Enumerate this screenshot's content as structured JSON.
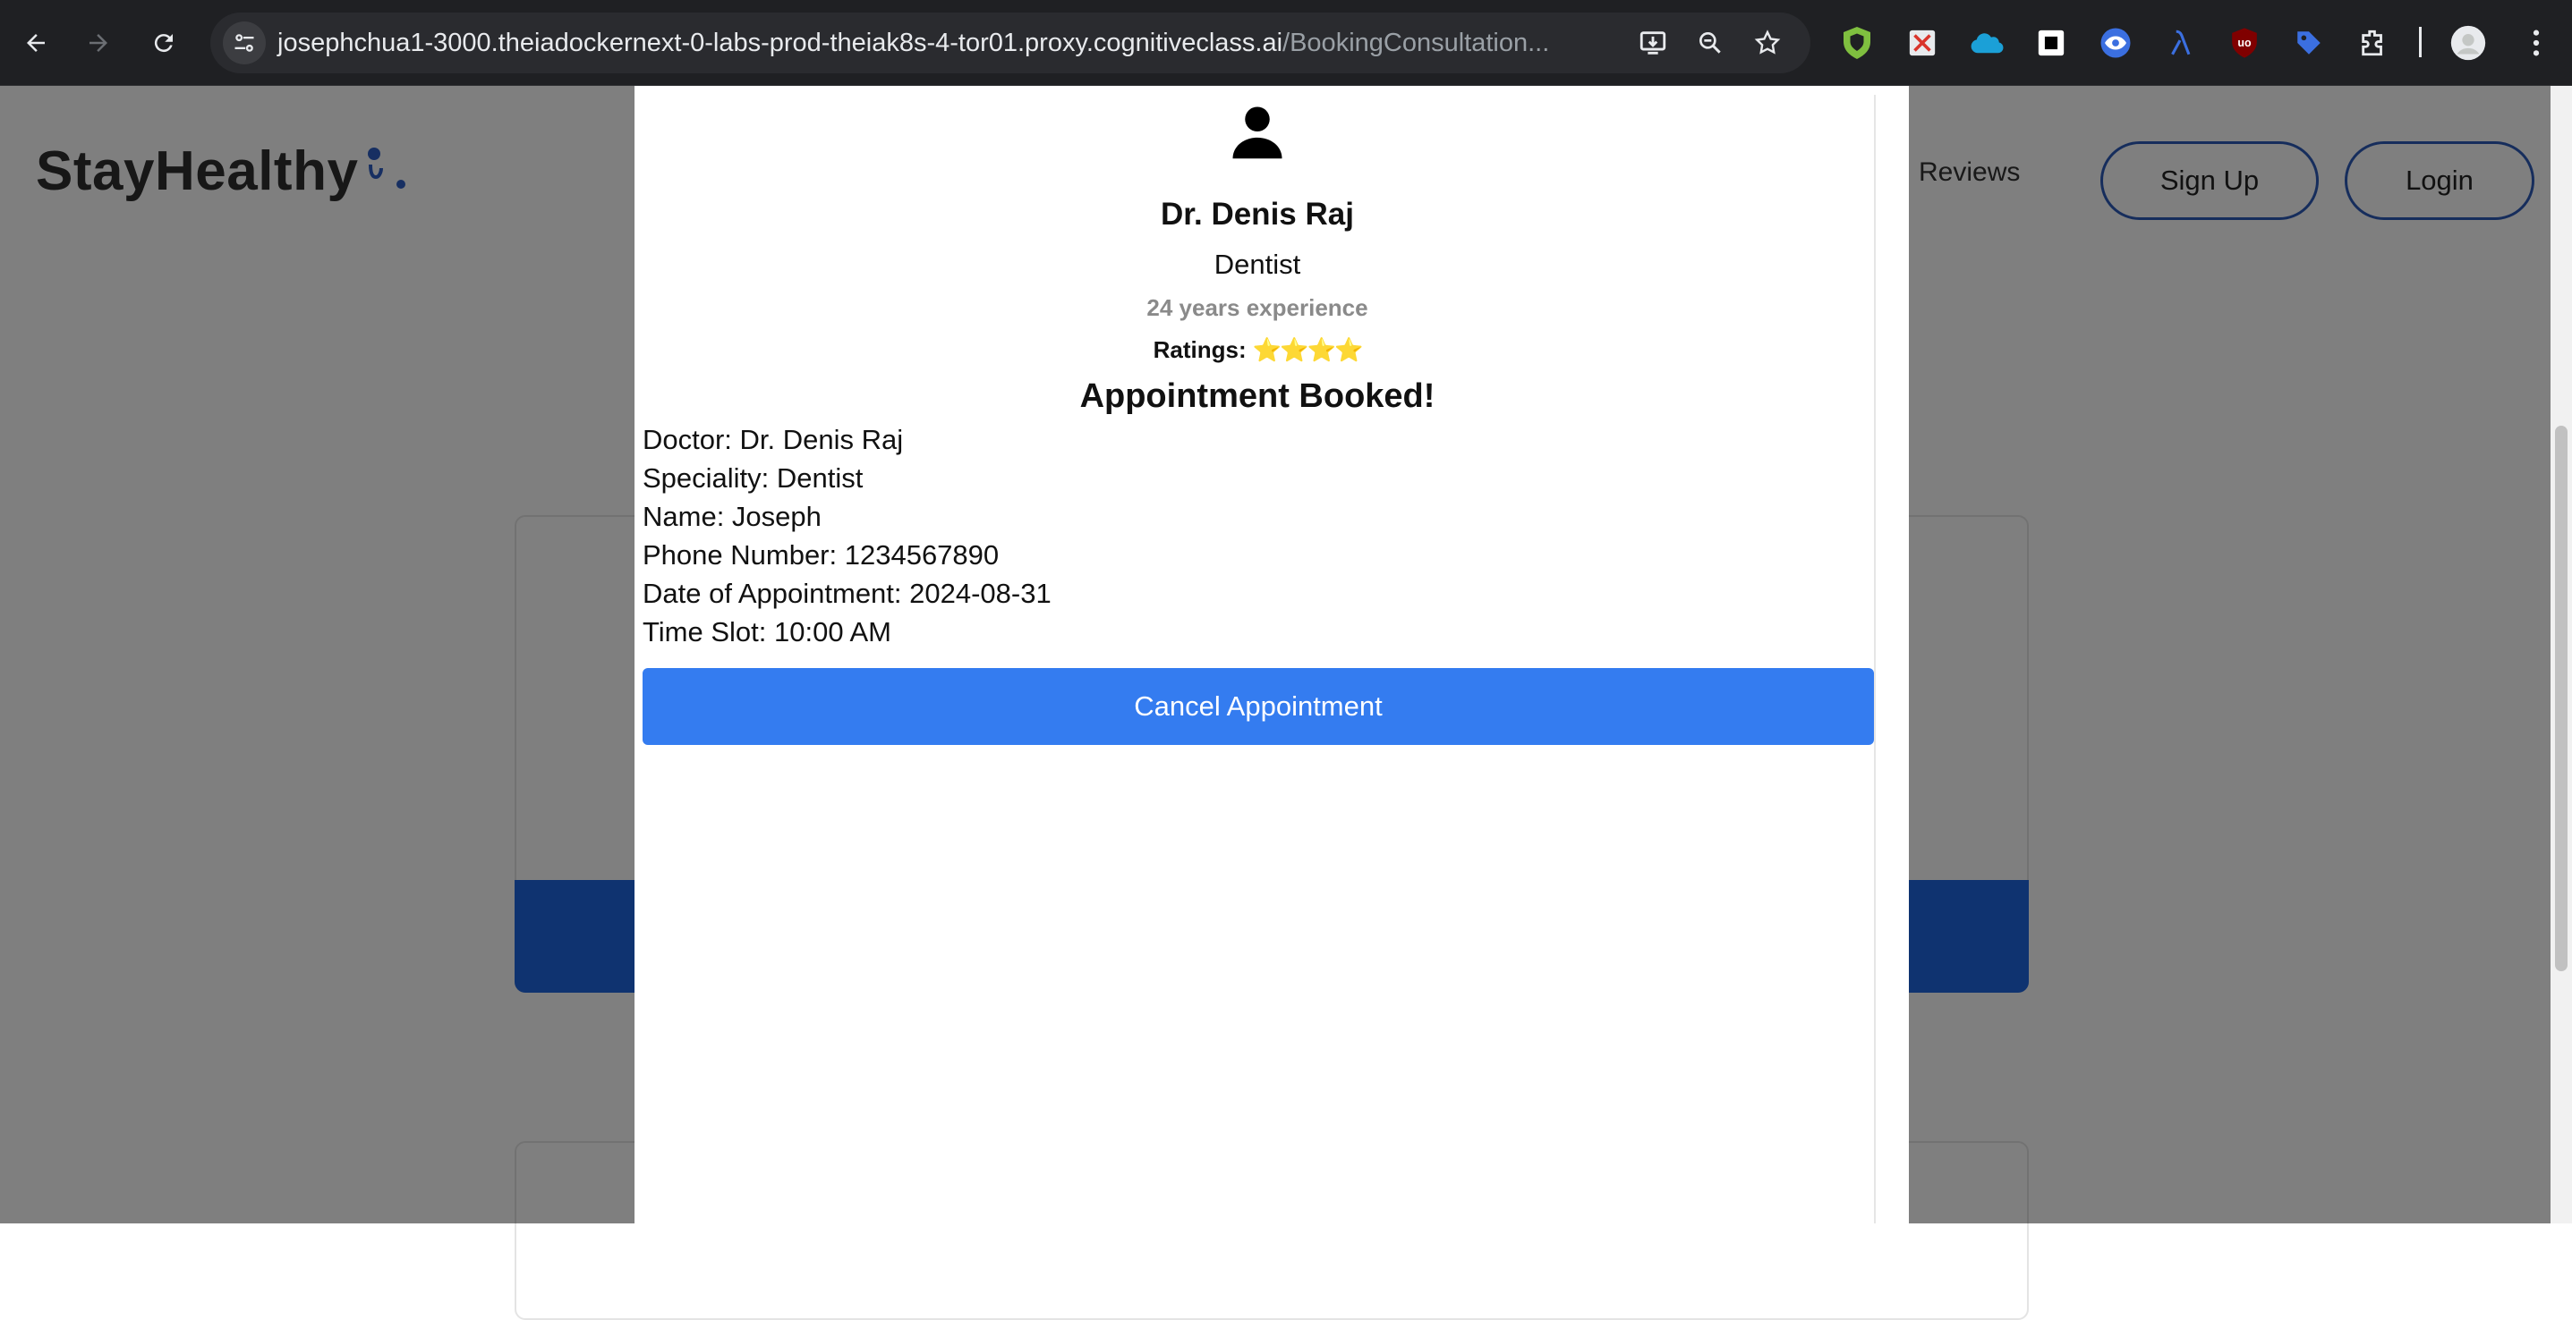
{
  "browser": {
    "url_host": "josephchua1-3000.theiadockernext-0-labs-prod-theiak8s-4-tor01.proxy.cognitiveclass.ai",
    "url_path": "/BookingConsultation..."
  },
  "site": {
    "logo_text": "StayHealthy",
    "nav_reviews": "Reviews",
    "signup_label": "Sign Up",
    "login_label": "Login"
  },
  "modal": {
    "doctor_name": "Dr. Denis Raj",
    "speciality": "Dentist",
    "experience": "24 years experience",
    "ratings_label": "Ratings:",
    "ratings_stars": "⭐⭐⭐⭐",
    "booked_title": "Appointment Booked!",
    "details": [
      "Doctor: Dr. Denis Raj",
      "Speciality: Dentist",
      "Name: Joseph",
      "Phone Number: 1234567890",
      "Date of Appointment: 2024-08-31",
      "Time Slot: 10:00 AM"
    ],
    "cancel_label": "Cancel Appointment"
  },
  "colors": {
    "accent": "#347cf0",
    "brand_outline": "#2d5bb9",
    "overlay": "rgba(0,0,0,0.5)"
  },
  "icons": [
    "back-icon",
    "forward-icon",
    "reload-icon",
    "site-info-icon",
    "install-icon",
    "zoom-icon",
    "bookmark-star-icon",
    "extension-icons",
    "puzzle-icon",
    "profile-avatar",
    "menu-kebab-icon",
    "person-icon"
  ]
}
